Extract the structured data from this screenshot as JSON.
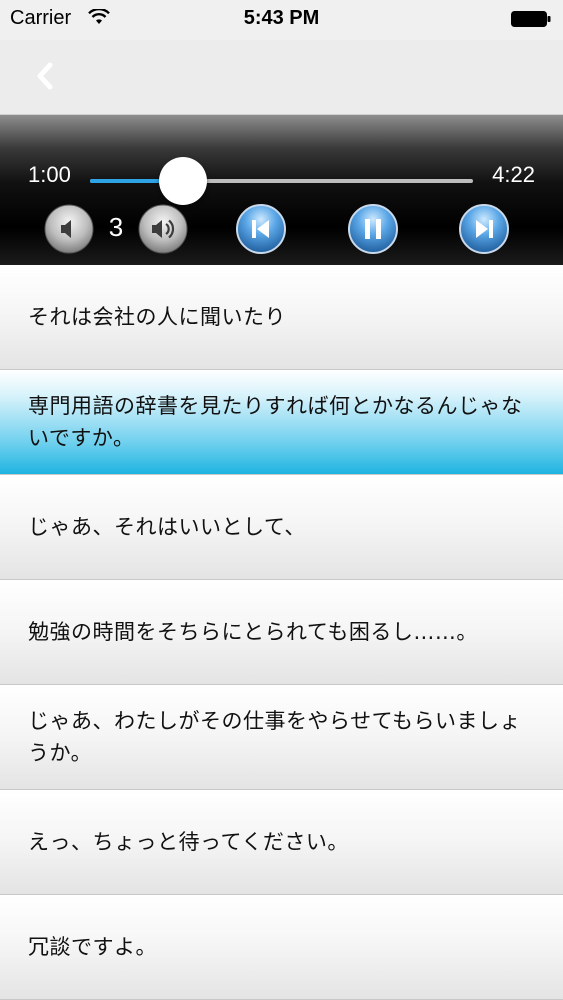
{
  "status_bar": {
    "carrier": "Carrier",
    "time": "5:43 PM"
  },
  "nav": {
    "back_icon": "chevron-left-icon"
  },
  "player": {
    "current_time": "1:00",
    "total_time": "4:22",
    "progress_fraction": 0.243,
    "volume_level": "3",
    "accent_color": "#2ea3e6",
    "controls": [
      "volume-down-icon",
      "volume-up-icon",
      "skip-previous-icon",
      "pause-icon",
      "skip-next-icon"
    ]
  },
  "transcript": {
    "active_index": 1,
    "active_color": "#1fb4e1",
    "lines": [
      "それは会社の人に聞いたり",
      "専門用語の辞書を見たりすれば何とかなるんじゃないですか。",
      "じゃあ、それはいいとして、",
      "勉強の時間をそちらにとられても困るし……。",
      "じゃあ、わたしがその仕事をやらせてもらいましょうか。",
      "えっ、ちょっと待ってください。",
      "冗談ですよ。"
    ]
  }
}
